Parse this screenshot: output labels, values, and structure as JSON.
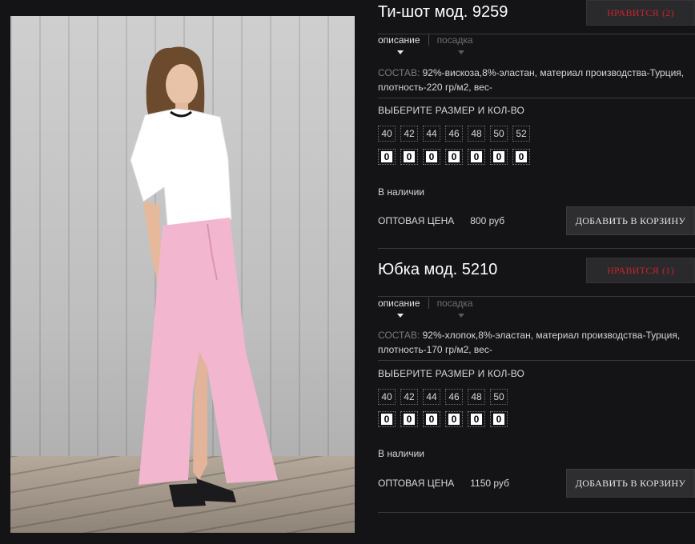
{
  "colors": {
    "background": "#141417",
    "like_text": "#c8232c",
    "button_bg": "#2e2e31"
  },
  "photo": {
    "alt": "model-photo"
  },
  "products": [
    {
      "title": "Ти-шот мод. 9259",
      "like_label": "НРАВИТСЯ",
      "like_count": "(2)",
      "tabs": [
        "описание",
        "посадка"
      ],
      "composition_label": "СОСТАВ:",
      "composition_text": " 92%-вискоза,8%-эластан, материал производства-Турция, плотность-220 гр/м2, вес-",
      "size_title": "ВЫБЕРИТЕ РАЗМЕР И КОЛ-ВО",
      "sizes": [
        "40",
        "42",
        "44",
        "46",
        "48",
        "50",
        "52"
      ],
      "quantities": [
        "0",
        "0",
        "0",
        "0",
        "0",
        "0",
        "0"
      ],
      "stock": "В наличии",
      "price_label": "ОПТОВАЯ ЦЕНА",
      "price": "800 руб",
      "cart_label": "ДОБАВИТЬ В КОРЗИНУ"
    },
    {
      "title": "Юбка мод. 5210",
      "like_label": "НРАВИТСЯ",
      "like_count": "(1)",
      "tabs": [
        "описание",
        "посадка"
      ],
      "composition_label": "СОСТАВ:",
      "composition_text": " 92%-хлопок,8%-эластан, материал производства-Турция, плотность-170 гр/м2, вес-",
      "size_title": "ВЫБЕРИТЕ РАЗМЕР И КОЛ-ВО",
      "sizes": [
        "40",
        "42",
        "44",
        "46",
        "48",
        "50"
      ],
      "quantities": [
        "0",
        "0",
        "0",
        "0",
        "0",
        "0"
      ],
      "stock": "В наличии",
      "price_label": "ОПТОВАЯ ЦЕНА",
      "price": "1150 руб",
      "cart_label": "ДОБАВИТЬ В КОРЗИНУ"
    }
  ]
}
